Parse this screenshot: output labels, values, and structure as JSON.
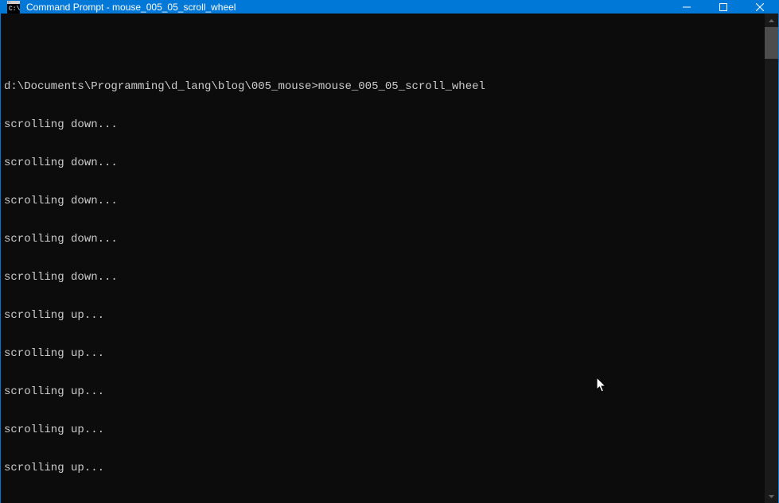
{
  "titlebar": {
    "title": "Command Prompt - mouse_005_05_scroll_wheel"
  },
  "terminal": {
    "prompt_path": "d:\\Documents\\Programming\\d_lang\\blog\\005_mouse>",
    "prompt_command": "mouse_005_05_scroll_wheel",
    "lines": [
      "scrolling down...",
      "scrolling down...",
      "scrolling down...",
      "scrolling down...",
      "scrolling down...",
      "scrolling up...",
      "scrolling up...",
      "scrolling up...",
      "scrolling up...",
      "scrolling up..."
    ]
  }
}
